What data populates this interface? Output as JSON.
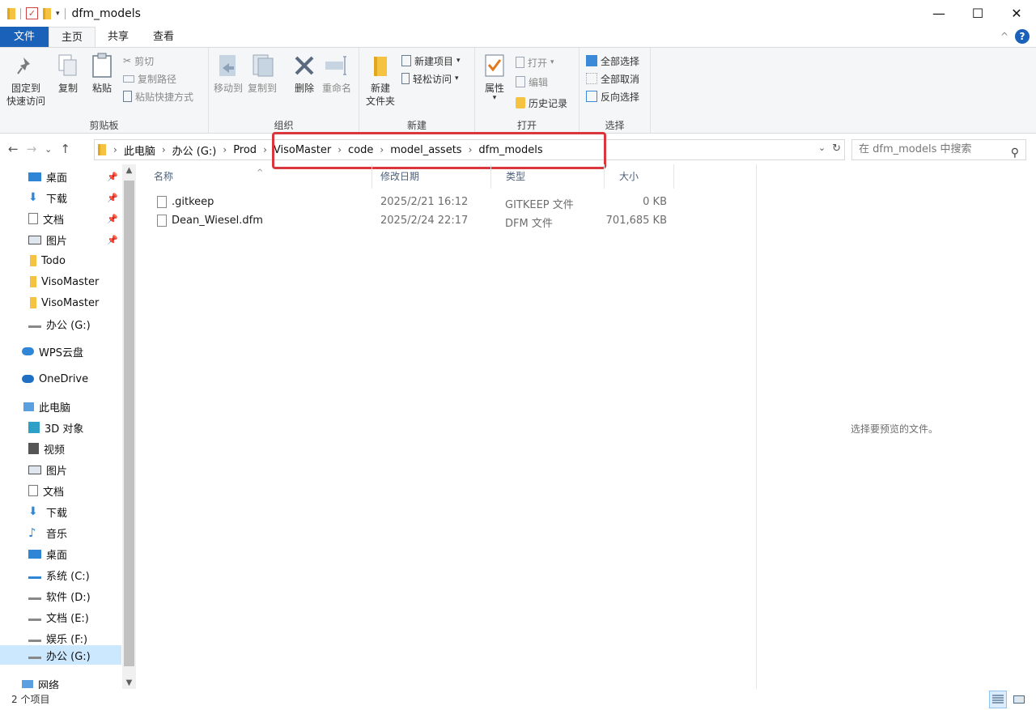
{
  "window": {
    "title": "dfm_models",
    "minimize": "—",
    "maximize": "☐",
    "close": "✕"
  },
  "ribbon_tabs": [
    {
      "label": "文件"
    },
    {
      "label": "主页"
    },
    {
      "label": "共享"
    },
    {
      "label": "查看"
    }
  ],
  "ribbon": {
    "clipboard": {
      "pin_label_1": "固定到",
      "pin_label_2": "快速访问",
      "copy": "复制",
      "paste": "粘贴",
      "cut": "剪切",
      "copy_path": "复制路径",
      "paste_shortcut": "粘贴快捷方式",
      "group": "剪贴板"
    },
    "organize": {
      "move_to": "移动到",
      "copy_to": "复制到",
      "delete": "删除",
      "rename": "重命名",
      "group": "组织"
    },
    "new": {
      "new_folder_1": "新建",
      "new_folder_2": "文件夹",
      "new_item": "新建项目",
      "easy_access": "轻松访问",
      "group": "新建"
    },
    "open": {
      "properties": "属性",
      "open": "打开",
      "edit": "编辑",
      "history": "历史记录",
      "group": "打开"
    },
    "select": {
      "select_all": "全部选择",
      "select_none": "全部取消",
      "invert": "反向选择",
      "group": "选择"
    }
  },
  "address": {
    "crumbs": [
      "此电脑",
      "办公 (G:)",
      "Prod",
      "VisoMaster",
      "code",
      "model_assets",
      "dfm_models"
    ],
    "search_placeholder": "在 dfm_models 中搜索"
  },
  "sidebar": {
    "items": [
      {
        "label": "桌面",
        "icon": "desktop-icon",
        "pinned": true
      },
      {
        "label": "下载",
        "icon": "download-icon",
        "pinned": true
      },
      {
        "label": "文档",
        "icon": "document-icon",
        "pinned": true
      },
      {
        "label": "图片",
        "icon": "picture-icon",
        "pinned": true
      },
      {
        "label": "Todo",
        "icon": "folder-icon"
      },
      {
        "label": "VisoMaster",
        "icon": "folder-icon"
      },
      {
        "label": "VisoMaster",
        "icon": "folder-icon"
      },
      {
        "label": "办公 (G:)",
        "icon": "drive-icon"
      },
      {
        "label": "WPS云盘",
        "icon": "cloud-icon"
      },
      {
        "label": "OneDrive",
        "icon": "cloud-icon"
      },
      {
        "label": "此电脑",
        "icon": "computer-icon"
      },
      {
        "label": "3D 对象",
        "icon": "3d-objects-icon"
      },
      {
        "label": "视频",
        "icon": "video-icon"
      },
      {
        "label": "图片",
        "icon": "picture-icon"
      },
      {
        "label": "文档",
        "icon": "document-icon"
      },
      {
        "label": "下载",
        "icon": "download-icon"
      },
      {
        "label": "音乐",
        "icon": "music-icon"
      },
      {
        "label": "桌面",
        "icon": "desktop-icon"
      },
      {
        "label": "系统 (C:)",
        "icon": "system-drive-icon"
      },
      {
        "label": "软件 (D:)",
        "icon": "drive-icon"
      },
      {
        "label": "文档 (E:)",
        "icon": "drive-icon"
      },
      {
        "label": "娱乐 (F:)",
        "icon": "drive-icon"
      },
      {
        "label": "办公 (G:)",
        "icon": "drive-icon",
        "selected": true
      },
      {
        "label": "网络",
        "icon": "network-icon"
      }
    ]
  },
  "filelist": {
    "columns": [
      "名称",
      "修改日期",
      "类型",
      "大小"
    ],
    "rows": [
      {
        "name": ".gitkeep",
        "modified": "2025/2/21 16:12",
        "type": "GITKEEP 文件",
        "size": "0 KB"
      },
      {
        "name": "Dean_Wiesel.dfm",
        "modified": "2025/2/24 22:17",
        "type": "DFM 文件",
        "size": "701,685 KB"
      }
    ]
  },
  "preview": {
    "text": "选择要预览的文件。"
  },
  "status": {
    "count": "2 个项目"
  },
  "colors": {
    "accent": "#1a62b9",
    "highlight_box": "#d9363e",
    "selected_bg": "#cce8ff"
  }
}
